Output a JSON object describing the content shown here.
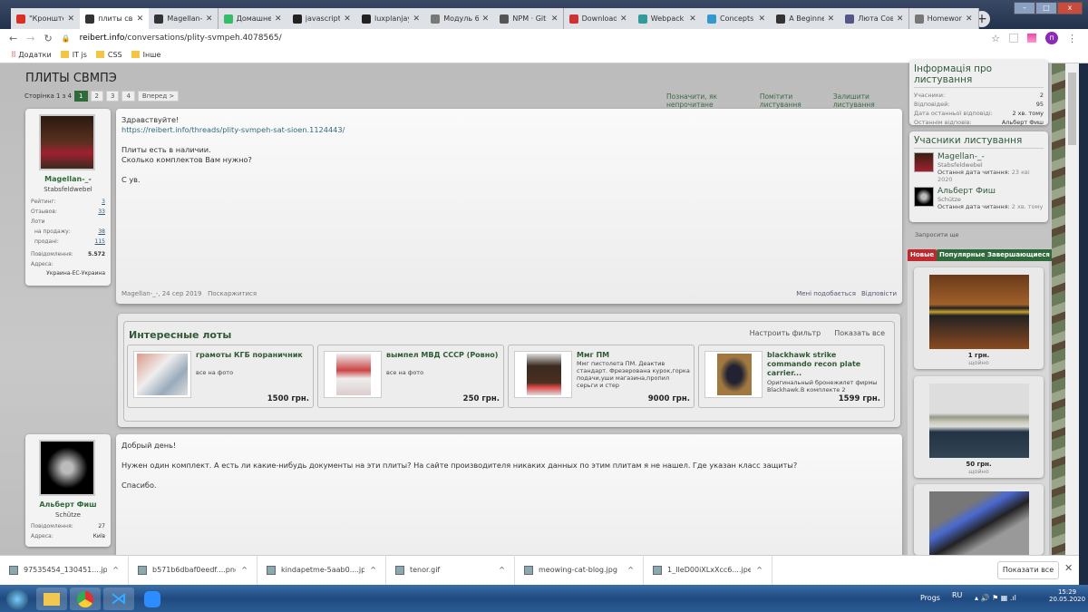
{
  "browser": {
    "tabs": [
      {
        "label": "\"Кронште",
        "color": "#d93025"
      },
      {
        "label": "плиты свм",
        "color": "#333"
      },
      {
        "label": "Magellan-",
        "color": "#333"
      },
      {
        "label": "Домашне",
        "color": "#3b6"
      },
      {
        "label": "javascript",
        "color": "#222"
      },
      {
        "label": "luxplanjay",
        "color": "#222"
      },
      {
        "label": "Модуль 6",
        "color": "#777"
      },
      {
        "label": "NPM · Git",
        "color": "#555"
      },
      {
        "label": "Download",
        "color": "#c33"
      },
      {
        "label": "Webpack",
        "color": "#399"
      },
      {
        "label": "Concepts",
        "color": "#39c"
      },
      {
        "label": "A Beginne",
        "color": "#333"
      },
      {
        "label": "Люта Сов",
        "color": "#558"
      },
      {
        "label": "Homework",
        "color": "#777"
      }
    ],
    "url_domain": "reibert.info",
    "url_path": "/conversations/plity-svmpeh.4078565/",
    "profile_initial": "п",
    "bookmarks": [
      "Додатки",
      "IT js",
      "CSS",
      "Інше"
    ]
  },
  "thread": {
    "title": "ПЛИТЫ СВМПЭ",
    "pager_label": "Сторінка 1 з 4",
    "pages": [
      "1",
      "2",
      "3",
      "4"
    ],
    "next": "Вперед >",
    "actions": [
      "Позначити, як непрочитане",
      "Помітити листування",
      "Залишити листування"
    ]
  },
  "posts": [
    {
      "author": "Magellan-_-",
      "rank": "Stabsfeldwebel",
      "stats": [
        {
          "label": "Рейтинг:",
          "value": "3"
        },
        {
          "label": "Отзывов:",
          "value": "33"
        },
        {
          "label": "Лоти",
          "value": ""
        },
        {
          "label": "на продажу:",
          "value": "38"
        },
        {
          "label": "продані:",
          "value": "115"
        },
        {
          "label": "Повідомлення:",
          "value": "5.572"
        },
        {
          "label": "Адреса:",
          "value": ""
        }
      ],
      "address": "Украина-ЕС-Украина",
      "lines": [
        "Здравствуйте!",
        "https://reibert.info/threads/plity-svmpeh-sat-sioen.1124443/",
        "",
        "Плиты есть в наличии.",
        "Сколько комплектов Вам нужно?",
        "",
        "С ув."
      ],
      "meta": "Magellan-_-, 24 сер 2019",
      "report": "Поскаржитися",
      "like": "Мені подобається",
      "reply": "Відповісти"
    },
    {
      "author": "Альберт Фиш",
      "rank": "Schütze",
      "stats": [
        {
          "label": "Повідомлення:",
          "value": "27"
        },
        {
          "label": "Адреса:",
          "value": "Київ"
        }
      ],
      "lines": [
        "Добрый день!",
        "",
        "Нужен один комплект. А есть ли какие-нибудь документы на эти плиты? На сайте производителя никаких данных по этим плитам я не нашел. Где указан класс защиты?",
        "",
        "Спасибо."
      ]
    }
  ],
  "lots": {
    "title": "Интересные лоты",
    "filter": "Настроить фильтр",
    "show_all": "Показать все",
    "items": [
      {
        "title": "грамоты КГБ пораничник",
        "desc": "все на фото",
        "price": "1500 грн."
      },
      {
        "title": "вымпел МВД СССР (Ровно)",
        "desc": "все на фото",
        "price": "250 грн."
      },
      {
        "title": "Ммг ПМ",
        "desc": "Ммг пистолета ПМ. Деактив стандарт. Фрезерована курок,горка подачи,уши магазина,пропил серьги и стер",
        "price": "9000 грн."
      },
      {
        "title": "blackhawk strike commando recon plate carrier...",
        "desc": "Оригинальный бронежилет фирмы Blackhawk.В комплекте 2",
        "price": "1599 грн."
      }
    ]
  },
  "sidebar": {
    "info_title": "Інформація про листування",
    "info": [
      {
        "label": "Учасники:",
        "value": "2"
      },
      {
        "label": "Відповідей:",
        "value": "95"
      },
      {
        "label": "Дата останньої відповіді:",
        "value": "2 хв. тому"
      },
      {
        "label": "Останнім відповів:",
        "value": "Альберт Фиш"
      }
    ],
    "participants_title": "Учасники листування",
    "participants": [
      {
        "name": "Magellan-_-",
        "rank": "Stabsfeldwebel",
        "read_label": "Остання дата читання:",
        "read": "23 кві 2020"
      },
      {
        "name": "Альберт Фиш",
        "rank": "Schütze",
        "read_label": "Остання дата читання:",
        "read": "2 хв. тому"
      }
    ],
    "invite": "Запросити ще",
    "tabs": [
      "Новые",
      "Популярные",
      "Завершающиеся"
    ],
    "cards": [
      {
        "price": "1 грн.",
        "when": "щойно"
      },
      {
        "price": "50 грн.",
        "when": "щойно"
      }
    ]
  },
  "downloads": {
    "files": [
      "97535454_130451....jpg",
      "b571b6dbaf0eedf....png",
      "kindapetme-5aab0....jpg",
      "tenor.gif",
      "meowing-cat-blog.jpg",
      "1_IIeD00iXLxXcc6....jpeg"
    ],
    "show_all": "Показати все"
  },
  "taskbar": {
    "progs": "Progs",
    "lang": "RU",
    "time": "15:29",
    "date": "20.05.2020"
  }
}
